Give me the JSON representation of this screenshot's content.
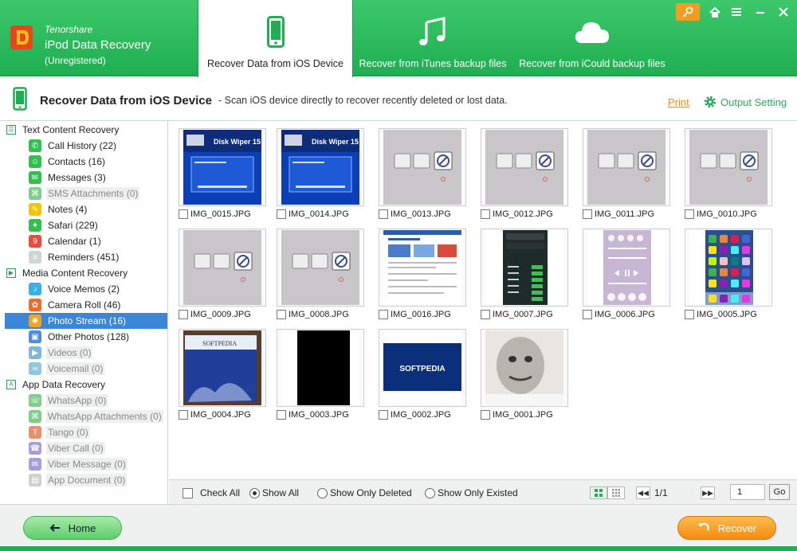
{
  "brand": {
    "company": "Tenorshare",
    "product": "iPod Data Recovery",
    "status": "(Unregistered)"
  },
  "tabs": [
    {
      "label": "Recover Data from iOS Device",
      "icon": "phone-icon",
      "active": true
    },
    {
      "label": "Recover from iTunes backup files",
      "icon": "music-note-icon",
      "active": false
    },
    {
      "label": "Recover from iCould backup files",
      "icon": "cloud-icon",
      "active": false
    }
  ],
  "window_controls": [
    "key-icon",
    "home-icon",
    "minimize-icon",
    "close-icon"
  ],
  "title_bar": {
    "title": "Recover Data from iOS Device",
    "description": "- Scan iOS device directly to recover recently deleted or lost data.",
    "print_label": "Print",
    "output_setting_label": "Output Setting"
  },
  "sidebar": {
    "categories": [
      {
        "label": "Text Content Recovery",
        "items": [
          {
            "label": "Call History (22)",
            "icon": "phone-call-icon",
            "color": "#2ec24c",
            "dim": false
          },
          {
            "label": "Contacts (16)",
            "icon": "contacts-icon",
            "color": "#2ec24c",
            "dim": false
          },
          {
            "label": "Messages (3)",
            "icon": "message-icon",
            "color": "#2ec24c",
            "dim": false
          },
          {
            "label": "SMS Attachments (0)",
            "icon": "attachment-icon",
            "color": "#7fcf8a",
            "dim": true
          },
          {
            "label": "Notes (4)",
            "icon": "notes-icon",
            "color": "#f5c400",
            "dim": false
          },
          {
            "label": "Safari (229)",
            "icon": "safari-icon",
            "color": "#2ec24c",
            "dim": false
          },
          {
            "label": "Calendar (1)",
            "icon": "calendar-icon",
            "color": "#e74c3c",
            "dim": false
          },
          {
            "label": "Reminders (451)",
            "icon": "reminders-icon",
            "color": "#cfd6d2",
            "dim": false
          }
        ]
      },
      {
        "label": "Media Content Recovery",
        "items": [
          {
            "label": "Voice Memos (2)",
            "icon": "microphone-icon",
            "color": "#3ab0e8",
            "dim": false
          },
          {
            "label": "Camera Roll (46)",
            "icon": "camera-roll-icon",
            "color": "#f06a2c",
            "dim": false
          },
          {
            "label": "Photo Stream (16)",
            "icon": "photo-stream-icon",
            "color": "#f3a321",
            "dim": false,
            "selected": true
          },
          {
            "label": "Other Photos (128)",
            "icon": "other-photos-icon",
            "color": "#4b8de0",
            "dim": false
          },
          {
            "label": "Videos (0)",
            "icon": "video-icon",
            "color": "#7fb7da",
            "dim": true
          },
          {
            "label": "Voicemail (0)",
            "icon": "voicemail-icon",
            "color": "#8fc7df",
            "dim": true
          }
        ]
      },
      {
        "label": "App Data Recovery",
        "items": [
          {
            "label": "WhatsApp (0)",
            "icon": "whatsapp-icon",
            "color": "#7fcf8a",
            "dim": true
          },
          {
            "label": "WhatsApp Attachments (0)",
            "icon": "attachment-icon",
            "color": "#7fcf8a",
            "dim": true
          },
          {
            "label": "Tango (0)",
            "icon": "tango-icon",
            "color": "#e88f6d",
            "dim": true
          },
          {
            "label": "Viber Call (0)",
            "icon": "viber-call-icon",
            "color": "#a89fd8",
            "dim": true
          },
          {
            "label": "Viber Message (0)",
            "icon": "viber-message-icon",
            "color": "#a89fd8",
            "dim": true
          },
          {
            "label": "App Document (0)",
            "icon": "document-icon",
            "color": "#d0d0d0",
            "dim": true
          }
        ]
      }
    ]
  },
  "photos": [
    {
      "name": "IMG_0015.JPG",
      "kind": "blue-screen",
      "text": "Disk Wiper 15"
    },
    {
      "name": "IMG_0014.JPG",
      "kind": "blue-screen",
      "text": "Disk Wiper 15"
    },
    {
      "name": "IMG_0013.JPG",
      "kind": "usb-photo"
    },
    {
      "name": "IMG_0012.JPG",
      "kind": "usb-photo"
    },
    {
      "name": "IMG_0011.JPG",
      "kind": "usb-photo"
    },
    {
      "name": "IMG_0010.JPG",
      "kind": "usb-photo"
    },
    {
      "name": "IMG_0009.JPG",
      "kind": "usb-photo"
    },
    {
      "name": "IMG_0008.JPG",
      "kind": "usb-photo"
    },
    {
      "name": "IMG_0016.JPG",
      "kind": "webpage"
    },
    {
      "name": "IMG_0007.JPG",
      "kind": "dark-phone"
    },
    {
      "name": "IMG_0006.JPG",
      "kind": "control-center"
    },
    {
      "name": "IMG_0005.JPG",
      "kind": "home-screen"
    },
    {
      "name": "IMG_0004.JPG",
      "kind": "softpedia-box",
      "text": "SOFTPEDIA"
    },
    {
      "name": "IMG_0003.JPG",
      "kind": "black"
    },
    {
      "name": "IMG_0002.JPG",
      "kind": "softpedia-logo",
      "text": "SOFTPEDIA"
    },
    {
      "name": "IMG_0001.JPG",
      "kind": "face"
    }
  ],
  "bottom_bar": {
    "check_all": "Check All",
    "show_all": "Show All",
    "show_deleted": "Show Only Deleted",
    "show_existed": "Show Only Existed",
    "page_indicator": "1/1",
    "page_value": "1",
    "go_label": "Go"
  },
  "footer": {
    "home_label": "Home",
    "recover_label": "Recover"
  },
  "colors": {
    "brand_green": "#1fae52",
    "accent_orange": "#f58b12",
    "selection_blue": "#3a86d8"
  }
}
